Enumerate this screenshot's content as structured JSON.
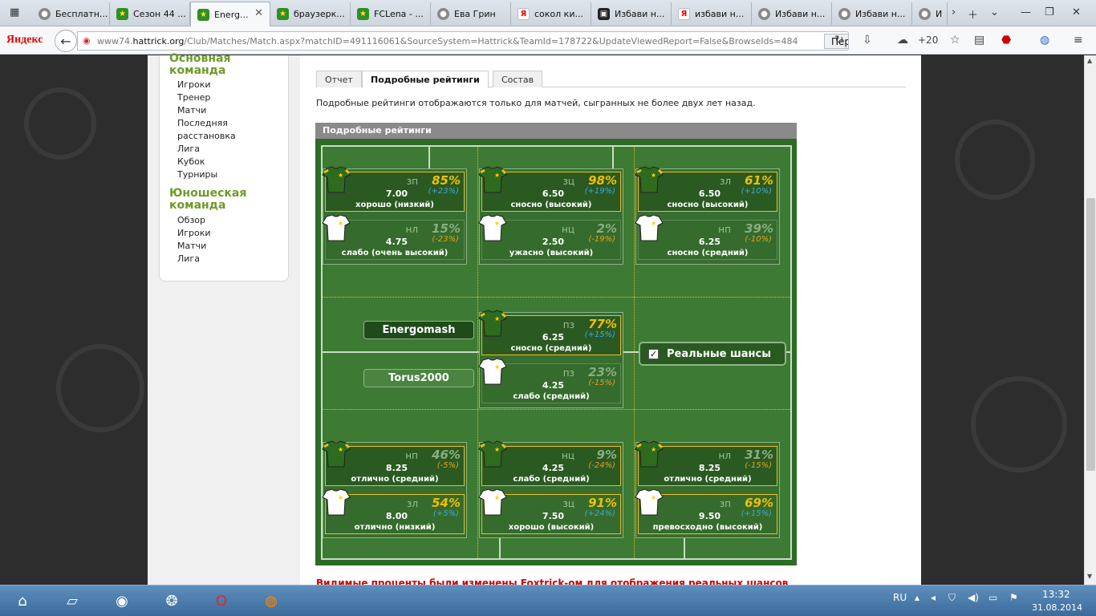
{
  "browser": {
    "tabs": [
      {
        "title": "Бесплатн...",
        "icon": "ball-icon"
      },
      {
        "title": "Сезон 44 ...",
        "icon": "hattrick-icon"
      },
      {
        "title": "Energ...",
        "icon": "hattrick-icon",
        "active": true
      },
      {
        "title": "браузерк...",
        "icon": "hattrick-icon"
      },
      {
        "title": "FCLena - ...",
        "icon": "hattrick-icon"
      },
      {
        "title": "Ева Грин",
        "icon": "ball-icon"
      },
      {
        "title": "сокол ки...",
        "icon": "yandex-icon"
      },
      {
        "title": "Избави н...",
        "icon": "film-icon"
      },
      {
        "title": "избави н...",
        "icon": "yandex-icon"
      },
      {
        "title": "Избави н...",
        "icon": "ball-icon"
      },
      {
        "title": "Избави н...",
        "icon": "ball-icon"
      },
      {
        "title": "И",
        "icon": "ball-icon"
      }
    ],
    "logo": "Яндекс",
    "url_prefix": "www74.",
    "url_domain": "hattrick.org",
    "url_rest": "/Club/Matches/Match.aspx?matchID=491116061&SourceSystem=Hattrick&TeamId=178722&UpdateViewedReport=False&BrowseIds=484",
    "translate_label": "Перевести",
    "weather": "+20"
  },
  "sidebar": {
    "main_team_title": "Основная команда",
    "main_team_items": [
      "Игроки",
      "Тренер",
      "Матчи",
      "Последняя",
      "расстановка",
      "Лига",
      "Кубок",
      "Турниры"
    ],
    "youth_team_title": "Юношеская команда",
    "youth_team_items": [
      "Обзор",
      "Игроки",
      "Матчи",
      "Лига"
    ]
  },
  "page_tabs": [
    "Отчет",
    "Подробные рейтинги",
    "Состав"
  ],
  "note": "Подробные рейтинги отображаются только для матчей, сыгранных не более двух лет назад.",
  "panel_title": "Подробные рейтинги",
  "ratings": {
    "top": [
      {
        "home": {
          "code": "зп",
          "value": "7.00",
          "pct": "85%",
          "diff": "(+23%)",
          "label": "хорошо (низкий)"
        },
        "away": {
          "code": "нл",
          "value": "4.75",
          "pct": "15%",
          "diff": "(-23%)",
          "label": "слабо (очень высокий)"
        }
      },
      {
        "home": {
          "code": "зц",
          "value": "6.50",
          "pct": "98%",
          "diff": "(+19%)",
          "label": "сносно (высокий)"
        },
        "away": {
          "code": "нц",
          "value": "2.50",
          "pct": "2%",
          "diff": "(-19%)",
          "label": "ужасно (высокий)"
        }
      },
      {
        "home": {
          "code": "зл",
          "value": "6.50",
          "pct": "61%",
          "diff": "(+10%)",
          "label": "сносно (высокий)"
        },
        "away": {
          "code": "нп",
          "value": "6.25",
          "pct": "39%",
          "diff": "(-10%)",
          "label": "сносно (средний)"
        }
      }
    ],
    "middle": {
      "home": {
        "code": "пз",
        "value": "6.25",
        "pct": "77%",
        "diff": "(+15%)",
        "label": "сносно (средний)"
      },
      "away": {
        "code": "пз",
        "value": "4.25",
        "pct": "23%",
        "diff": "(-15%)",
        "label": "слабо (средний)"
      }
    },
    "bottom": [
      {
        "home": {
          "code": "нп",
          "value": "8.25",
          "pct": "46%",
          "diff": "(-5%)",
          "label": "отлично (средний)"
        },
        "away": {
          "code": "зл",
          "value": "8.00",
          "pct": "54%",
          "diff": "(+5%)",
          "label": "отлично (низкий)"
        }
      },
      {
        "home": {
          "code": "нц",
          "value": "4.25",
          "pct": "9%",
          "diff": "(-24%)",
          "label": "слабо (средний)"
        },
        "away": {
          "code": "зц",
          "value": "7.50",
          "pct": "91%",
          "diff": "(+24%)",
          "label": "хорошо (высокий)"
        }
      },
      {
        "home": {
          "code": "нл",
          "value": "8.25",
          "pct": "31%",
          "diff": "(-15%)",
          "label": "отлично (средний)"
        },
        "away": {
          "code": "зп",
          "value": "9.50",
          "pct": "69%",
          "diff": "(+15%)",
          "label": "превосходно (высокий)"
        }
      }
    ]
  },
  "teams": {
    "home": "Energomash",
    "away": "Torus2000"
  },
  "real_chances_label": "Реальные шансы",
  "footer_note": "Видимые проценты были изменены Foxtrick-ом для отображения реальных шансов",
  "taskbar": {
    "lang": "RU",
    "time": "13:32",
    "date": "31.08.2014"
  }
}
